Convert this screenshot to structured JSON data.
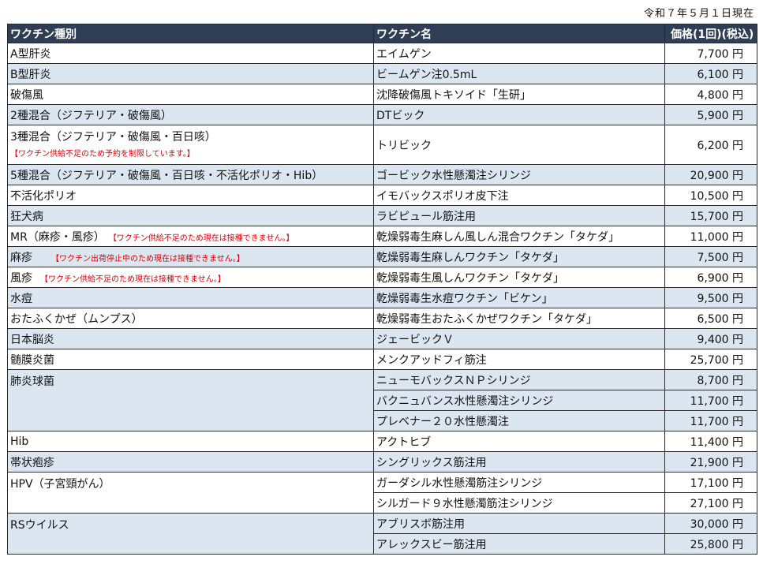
{
  "as_of": "令和７年５月１日現在",
  "headers": {
    "type": "ワクチン種別",
    "name": "ワクチン名",
    "price": "価格(1回)(税込)"
  },
  "rows": [
    {
      "type": "A型肝炎",
      "name": "エイムゲン",
      "price": "7,700 円"
    },
    {
      "type": "B型肝炎",
      "name": "ビームゲン注0.5mL",
      "price": "6,100 円"
    },
    {
      "type": "破傷風",
      "name": "沈降破傷風トキソイド「生研」",
      "price": "4,800 円"
    },
    {
      "type": "2種混合（ジフテリア・破傷風）",
      "name": "DTビック",
      "price": "5,900 円"
    },
    {
      "type": "3種混合（ジフテリア・破傷風・百日咳）",
      "note": "【ワクチン供給不足のため予約を制限しています。】",
      "name": "トリビック",
      "price": "6,200 円"
    },
    {
      "type": "5種混合（ジフテリア・破傷風・百日咳・不活化ポリオ・Hib）",
      "name": "ゴービック水性懸濁注シリンジ",
      "price": "20,900 円"
    },
    {
      "type": "不活化ポリオ",
      "name": "イモバックスポリオ皮下注",
      "price": "10,500 円"
    },
    {
      "type": "狂犬病",
      "name": "ラビピュール筋注用",
      "price": "15,700 円"
    },
    {
      "type": "MR（麻疹・風疹）",
      "note": "【ワクチン供給不足のため現在は接種できません。】",
      "name": "乾燥弱毒生麻しん風しん混合ワクチン「タケダ」",
      "price": "11,000 円"
    },
    {
      "type": "麻疹",
      "note": "【ワクチン出荷停止中のため現在は接種できません。】",
      "name": "乾燥弱毒生麻しんワクチン「タケダ」",
      "price": "7,500 円"
    },
    {
      "type": "風疹",
      "note": "【ワクチン供給不足のため現在は接種できません。】",
      "name": "乾燥弱毒生風しんワクチン「タケダ」",
      "price": "6,900 円"
    },
    {
      "type": "水痘",
      "name": "乾燥弱毒生水痘ワクチン「ビケン」",
      "price": "9,500 円"
    },
    {
      "type": "おたふくかぜ（ムンプス）",
      "name": "乾燥弱毒生おたふくかぜワクチン「タケダ」",
      "price": "6,500 円"
    },
    {
      "type": "日本脳炎",
      "name": "ジェービックＶ",
      "price": "9,400 円"
    },
    {
      "type": "髄膜炎菌",
      "name": "メンクアッドフィ筋注",
      "price": "25,700 円"
    },
    {
      "type": "肺炎球菌",
      "name": "ニューモバックスＮＰシリンジ",
      "price": "8,700 円"
    },
    {
      "name": "バクニュバンス水性懸濁注シリンジ",
      "price": "11,700 円"
    },
    {
      "name": "プレベナー２０水性懸濁注",
      "price": "11,700 円"
    },
    {
      "type": "Hib",
      "name": "アクトヒブ",
      "price": "11,400 円"
    },
    {
      "type": "帯状疱疹",
      "name": "シングリックス筋注用",
      "price": "21,900 円"
    },
    {
      "type": "HPV（子宮頸がん）",
      "name": "ガーダシル水性懸濁筋注シリンジ",
      "price": "17,100 円"
    },
    {
      "name": "シルガード９水性懸濁筋注シリンジ",
      "price": "27,100 円"
    },
    {
      "type": "RSウイルス",
      "name": "アブリスボ筋注用",
      "price": "30,000 円"
    },
    {
      "name": "アレックスビー筋注用",
      "price": "25,800 円"
    }
  ]
}
